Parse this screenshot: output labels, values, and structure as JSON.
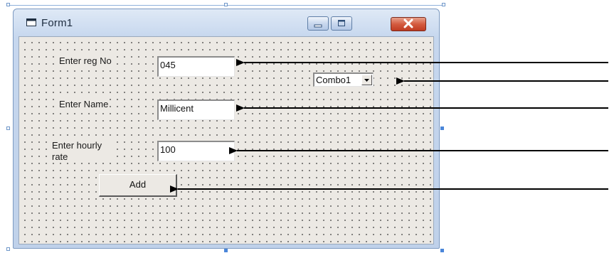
{
  "window": {
    "title": "Form1"
  },
  "form": {
    "reg_label": "Enter reg No",
    "reg_value": "045",
    "name_label": "Enter Name",
    "name_value": "Millicent",
    "rate_label": "Enter hourly rate",
    "rate_value": "100",
    "combo_text": "Combo1",
    "add_button": "Add"
  },
  "icons": {
    "title": "form-icon",
    "minimize": "minimize-icon",
    "maximize": "maximize-icon",
    "close": "close-icon",
    "combo": "dropdown-arrow-icon"
  },
  "colors": {
    "close_button": "#d45b3f",
    "form_background": "#ece9e4",
    "arrow": "#000000"
  }
}
